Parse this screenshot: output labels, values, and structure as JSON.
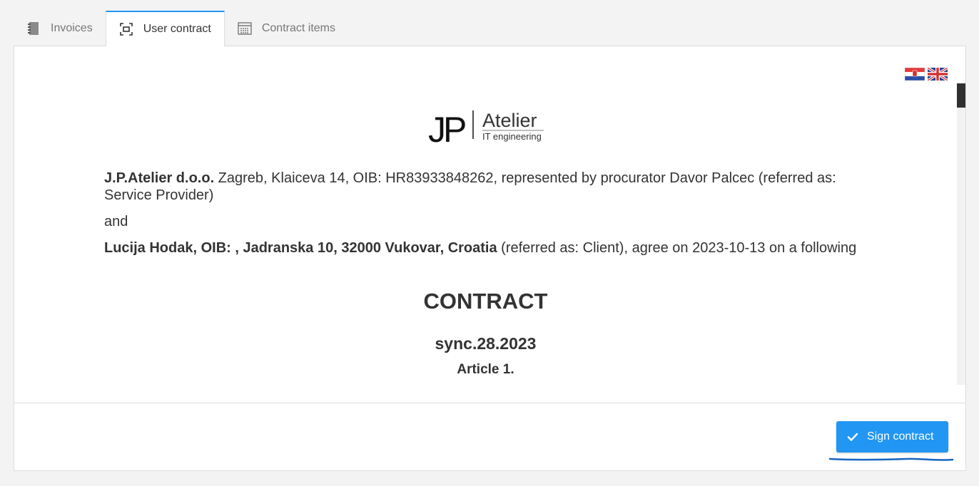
{
  "tabs": [
    {
      "label": "Invoices",
      "icon": "notebook-icon",
      "active": false
    },
    {
      "label": "User contract",
      "icon": "frame-select-icon",
      "active": true
    },
    {
      "label": "Contract items",
      "icon": "grid-list-icon",
      "active": false
    }
  ],
  "languages": [
    {
      "code": "hr",
      "icon": "croatia-flag-icon"
    },
    {
      "code": "en",
      "icon": "uk-flag-icon"
    }
  ],
  "logo": {
    "letters": "JP",
    "name": "Atelier",
    "tagline": "IT engineering"
  },
  "contract": {
    "provider_name": "J.P.Atelier d.o.o.",
    "provider_rest": " Zagreb, Klaiceva 14, OIB: HR83933848262, represented by procurator Davor Palcec (referred as: Service Provider)",
    "and": "and",
    "client_name": "Lucija Hodak, OIB: , Jadranska 10, 32000 Vukovar, Croatia",
    "client_rest": " (referred as: Client), agree on 2023-10-13 on a following",
    "title": "CONTRACT",
    "number": "sync.28.2023",
    "article": "Article 1."
  },
  "actions": {
    "sign_label": "Sign contract"
  },
  "colors": {
    "accent": "#2196f3",
    "underline": "#1565c0"
  }
}
